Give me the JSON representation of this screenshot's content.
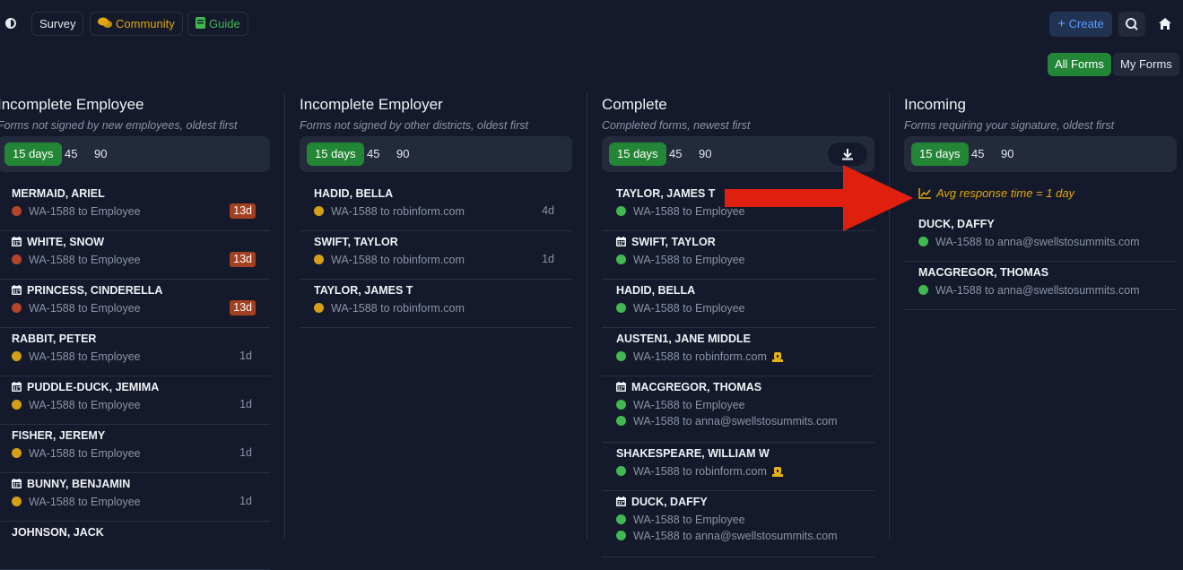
{
  "nav": {
    "survey": "Survey",
    "community": "Community",
    "guide": "Guide",
    "create": "Create"
  },
  "view_toggle": {
    "all_forms": "All Forms",
    "my_forms": "My Forms"
  },
  "colors": {
    "accent_green": "#238636",
    "overdue": "#a3401f",
    "status_red": "#b5452a",
    "status_amber": "#d4a017",
    "status_green": "#3fb950",
    "warning_text": "#e3a613"
  },
  "columns": [
    {
      "title": "Incomplete Employee",
      "subtitle": "Forms not signed by new employees, oldest first",
      "filters": [
        "15 days",
        "45",
        "90"
      ],
      "rows": [
        {
          "name": "MERMAID, ARIEL",
          "calendar": false,
          "lines": [
            {
              "status": "red",
              "text": "WA-1588 to Employee"
            }
          ],
          "age": "13d",
          "overdue": true
        },
        {
          "name": "WHITE, SNOW",
          "calendar": true,
          "lines": [
            {
              "status": "red",
              "text": "WA-1588 to Employee"
            }
          ],
          "age": "13d",
          "overdue": true
        },
        {
          "name": "PRINCESS, CINDERELLA",
          "calendar": true,
          "lines": [
            {
              "status": "red",
              "text": "WA-1588 to Employee"
            }
          ],
          "age": "13d",
          "overdue": true
        },
        {
          "name": "RABBIT, PETER",
          "calendar": false,
          "lines": [
            {
              "status": "amber",
              "text": "WA-1588 to Employee"
            }
          ],
          "age": "1d",
          "overdue": false
        },
        {
          "name": "PUDDLE-DUCK, JEMIMA",
          "calendar": true,
          "lines": [
            {
              "status": "amber",
              "text": "WA-1588 to Employee"
            }
          ],
          "age": "1d",
          "overdue": false
        },
        {
          "name": "FISHER, JEREMY",
          "calendar": false,
          "lines": [
            {
              "status": "amber",
              "text": "WA-1588 to Employee"
            }
          ],
          "age": "1d",
          "overdue": false
        },
        {
          "name": "BUNNY, BENJAMIN",
          "calendar": true,
          "lines": [
            {
              "status": "amber",
              "text": "WA-1588 to Employee"
            }
          ],
          "age": "1d",
          "overdue": false
        },
        {
          "name": "JOHNSON, JACK",
          "calendar": false,
          "lines": [],
          "age": "",
          "overdue": false
        }
      ]
    },
    {
      "title": "Incomplete Employer",
      "subtitle": "Forms not signed by other districts, oldest first",
      "filters": [
        "15 days",
        "45",
        "90"
      ],
      "rows": [
        {
          "name": "HADID, BELLA",
          "calendar": false,
          "lines": [
            {
              "status": "amber",
              "text": "WA-1588 to robinform.com"
            }
          ],
          "age": "4d",
          "overdue": false
        },
        {
          "name": "SWIFT, TAYLOR",
          "calendar": false,
          "lines": [
            {
              "status": "amber",
              "text": "WA-1588 to robinform.com"
            }
          ],
          "age": "1d",
          "overdue": false
        },
        {
          "name": "TAYLOR, JAMES T",
          "calendar": false,
          "lines": [
            {
              "status": "amber",
              "text": "WA-1588 to robinform.com"
            }
          ],
          "age": "",
          "overdue": false
        }
      ]
    },
    {
      "title": "Complete",
      "subtitle": "Completed forms, newest first",
      "filters": [
        "15 days",
        "45",
        "90"
      ],
      "download": true,
      "rows": [
        {
          "name": "TAYLOR, JAMES T",
          "calendar": false,
          "lines": [
            {
              "status": "green",
              "text": "WA-1588 to Employee"
            }
          ]
        },
        {
          "name": "SWIFT, TAYLOR",
          "calendar": true,
          "lines": [
            {
              "status": "green",
              "text": "WA-1588 to Employee"
            }
          ]
        },
        {
          "name": "HADID, BELLA",
          "calendar": false,
          "lines": [
            {
              "status": "green",
              "text": "WA-1588 to Employee"
            }
          ]
        },
        {
          "name": "AUSTEN1, JANE MIDDLE",
          "calendar": false,
          "lines": [
            {
              "status": "green",
              "text": "WA-1588 to robinform.com",
              "lock": true
            }
          ]
        },
        {
          "name": "MACGREGOR, THOMAS",
          "calendar": true,
          "lines": [
            {
              "status": "green",
              "text": "WA-1588 to Employee"
            },
            {
              "status": "green",
              "text": "WA-1588 to anna@swellstosummits.com"
            }
          ]
        },
        {
          "name": "SHAKESPEARE, WILLIAM W",
          "calendar": false,
          "lines": [
            {
              "status": "green",
              "text": "WA-1588 to robinform.com",
              "lock": true
            }
          ]
        },
        {
          "name": "DUCK, DAFFY",
          "calendar": true,
          "lines": [
            {
              "status": "green",
              "text": "WA-1588 to Employee"
            },
            {
              "status": "green",
              "text": "WA-1588 to anna@swellstosummits.com"
            }
          ]
        }
      ]
    },
    {
      "title": "Incoming",
      "subtitle": "Forms requiring your signature, oldest first",
      "filters": [
        "15 days",
        "45",
        "90"
      ],
      "avg_response": "Avg response time = 1 day",
      "rows": [
        {
          "name": "DUCK, DAFFY",
          "calendar": false,
          "lines": [
            {
              "status": "green",
              "text": "WA-1588 to anna@swellstosummits.com"
            }
          ]
        },
        {
          "name": "MACGREGOR, THOMAS",
          "calendar": false,
          "lines": [
            {
              "status": "green",
              "text": "WA-1588 to anna@swellstosummits.com"
            }
          ]
        }
      ]
    }
  ]
}
